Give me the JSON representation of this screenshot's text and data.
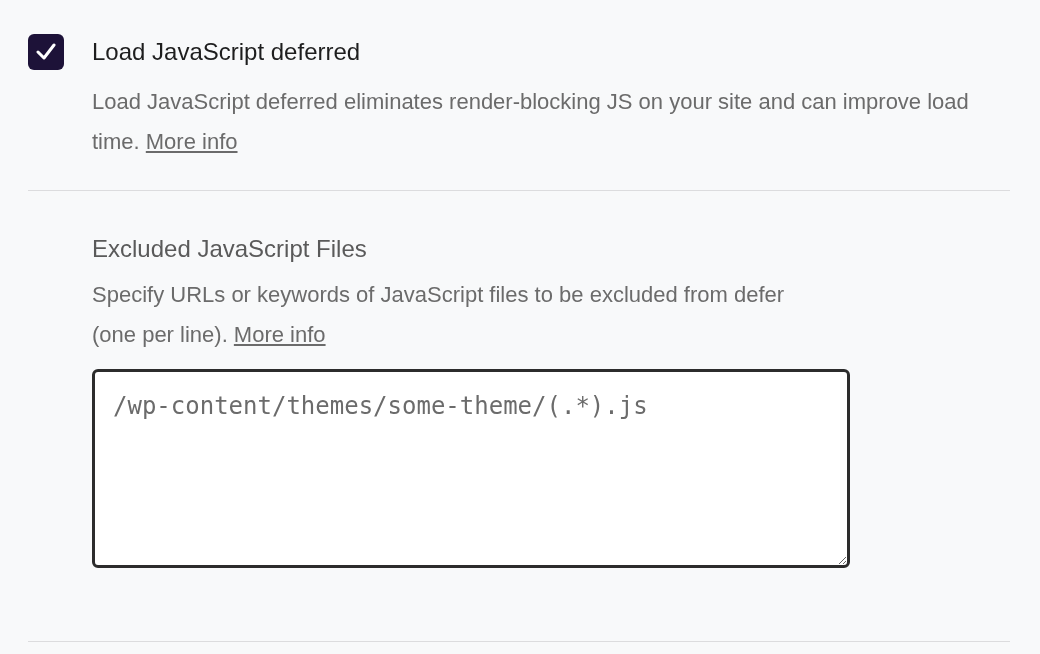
{
  "option": {
    "label": "Load JavaScript deferred",
    "checked": true,
    "description": "Load JavaScript deferred eliminates render-blocking JS on your site and can improve load time.",
    "link": "More info"
  },
  "excluded": {
    "heading": "Excluded JavaScript Files",
    "description": "Specify URLs or keywords of JavaScript files to be excluded from defer (one per line).",
    "link": "More info",
    "placeholder": "/wp-content/themes/some-theme/(.*).js"
  }
}
